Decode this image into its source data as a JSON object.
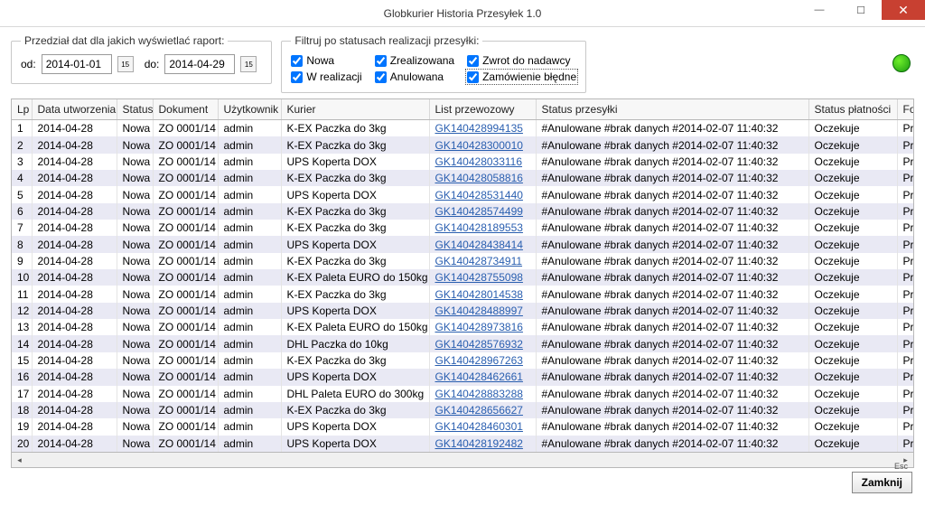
{
  "window": {
    "title": "Globkurier Historia Przesyłek 1.0"
  },
  "date_range": {
    "legend": "Przedział dat dla jakich wyświetlać raport:",
    "from_label": "od:",
    "from_value": "2014-01-01",
    "to_label": "do:",
    "to_value": "2014-04-29"
  },
  "filters": {
    "legend": "Filtruj po statusach realizacji przesyłki:",
    "nowa": "Nowa",
    "zrealizowana": "Zrealizowana",
    "zwrot": "Zwrot do nadawcy",
    "w_realizacji": "W realizacji",
    "anulowana": "Anulowana",
    "bledne": "Zamówienie błędne"
  },
  "columns": {
    "lp": "Lp",
    "data": "Data utworzenia",
    "status": "Status",
    "dokument": "Dokument",
    "uzytkownik": "Użytkownik",
    "kurier": "Kurier",
    "list": "List przewozowy",
    "status_p": "Status przesyłki",
    "status_pl": "Status płatności",
    "forma_pl": "Forma płatnoś"
  },
  "rows": [
    {
      "lp": "1",
      "data": "2014-04-28",
      "status": "Nowa",
      "dok": "ZO 0001/14",
      "user": "admin",
      "kurier": "K-EX Paczka do 3kg",
      "list": "GK140428994135",
      "sp": "#Anulowane #brak danych #2014-02-07 11:40:32",
      "spl": "Oczekuje",
      "fpl": "Przelew banko"
    },
    {
      "lp": "2",
      "data": "2014-04-28",
      "status": "Nowa",
      "dok": "ZO 0001/14",
      "user": "admin",
      "kurier": "K-EX Paczka do 3kg",
      "list": "GK140428300010",
      "sp": "#Anulowane #brak danych #2014-02-07 11:40:32",
      "spl": "Oczekuje",
      "fpl": "Przelew banko"
    },
    {
      "lp": "3",
      "data": "2014-04-28",
      "status": "Nowa",
      "dok": "ZO 0001/14",
      "user": "admin",
      "kurier": "UPS Koperta DOX",
      "list": "GK140428033116",
      "sp": "#Anulowane #brak danych #2014-02-07 11:40:32",
      "spl": "Oczekuje",
      "fpl": "Przelew banko"
    },
    {
      "lp": "4",
      "data": "2014-04-28",
      "status": "Nowa",
      "dok": "ZO 0001/14",
      "user": "admin",
      "kurier": "K-EX Paczka do 3kg",
      "list": "GK140428058816",
      "sp": "#Anulowane #brak danych #2014-02-07 11:40:32",
      "spl": "Oczekuje",
      "fpl": "Przelew banko"
    },
    {
      "lp": "5",
      "data": "2014-04-28",
      "status": "Nowa",
      "dok": "ZO 0001/14",
      "user": "admin",
      "kurier": "UPS Koperta DOX",
      "list": "GK140428531440",
      "sp": "#Anulowane #brak danych #2014-02-07 11:40:32",
      "spl": "Oczekuje",
      "fpl": "Przelew banko"
    },
    {
      "lp": "6",
      "data": "2014-04-28",
      "status": "Nowa",
      "dok": "ZO 0001/14",
      "user": "admin",
      "kurier": "K-EX Paczka do 3kg",
      "list": "GK140428574499",
      "sp": "#Anulowane #brak danych #2014-02-07 11:40:32",
      "spl": "Oczekuje",
      "fpl": "Przelew banko"
    },
    {
      "lp": "7",
      "data": "2014-04-28",
      "status": "Nowa",
      "dok": "ZO 0001/14",
      "user": "admin",
      "kurier": "K-EX Paczka do 3kg",
      "list": "GK140428189553",
      "sp": "#Anulowane #brak danych #2014-02-07 11:40:32",
      "spl": "Oczekuje",
      "fpl": "Przelew banko"
    },
    {
      "lp": "8",
      "data": "2014-04-28",
      "status": "Nowa",
      "dok": "ZO 0001/14",
      "user": "admin",
      "kurier": "UPS Koperta DOX",
      "list": "GK140428438414",
      "sp": "#Anulowane #brak danych #2014-02-07 11:40:32",
      "spl": "Oczekuje",
      "fpl": "Przelew banko"
    },
    {
      "lp": "9",
      "data": "2014-04-28",
      "status": "Nowa",
      "dok": "ZO 0001/14",
      "user": "admin",
      "kurier": "K-EX Paczka do 3kg",
      "list": "GK140428734911",
      "sp": "#Anulowane #brak danych #2014-02-07 11:40:32",
      "spl": "Oczekuje",
      "fpl": "Przelew banko"
    },
    {
      "lp": "10",
      "data": "2014-04-28",
      "status": "Nowa",
      "dok": "ZO 0001/14",
      "user": "admin",
      "kurier": "K-EX Paleta EURO do 150kg",
      "list": "GK140428755098",
      "sp": "#Anulowane #brak danych #2014-02-07 11:40:32",
      "spl": "Oczekuje",
      "fpl": "Przelew banko"
    },
    {
      "lp": "11",
      "data": "2014-04-28",
      "status": "Nowa",
      "dok": "ZO 0001/14",
      "user": "admin",
      "kurier": "K-EX Paczka do 3kg",
      "list": "GK140428014538",
      "sp": "#Anulowane #brak danych #2014-02-07 11:40:32",
      "spl": "Oczekuje",
      "fpl": "Przelew banko"
    },
    {
      "lp": "12",
      "data": "2014-04-28",
      "status": "Nowa",
      "dok": "ZO 0001/14",
      "user": "admin",
      "kurier": "UPS Koperta DOX",
      "list": "GK140428488997",
      "sp": "#Anulowane #brak danych #2014-02-07 11:40:32",
      "spl": "Oczekuje",
      "fpl": "Przelew banko"
    },
    {
      "lp": "13",
      "data": "2014-04-28",
      "status": "Nowa",
      "dok": "ZO 0001/14",
      "user": "admin",
      "kurier": "K-EX Paleta EURO do 150kg",
      "list": "GK140428973816",
      "sp": "#Anulowane #brak danych #2014-02-07 11:40:32",
      "spl": "Oczekuje",
      "fpl": "Przelew banko"
    },
    {
      "lp": "14",
      "data": "2014-04-28",
      "status": "Nowa",
      "dok": "ZO 0001/14",
      "user": "admin",
      "kurier": "DHL Paczka do 10kg",
      "list": "GK140428576932",
      "sp": "#Anulowane #brak danych #2014-02-07 11:40:32",
      "spl": "Oczekuje",
      "fpl": "Przelew banko"
    },
    {
      "lp": "15",
      "data": "2014-04-28",
      "status": "Nowa",
      "dok": "ZO 0001/14",
      "user": "admin",
      "kurier": "K-EX Paczka do 3kg",
      "list": "GK140428967263",
      "sp": "#Anulowane #brak danych #2014-02-07 11:40:32",
      "spl": "Oczekuje",
      "fpl": "Przelew banko"
    },
    {
      "lp": "16",
      "data": "2014-04-28",
      "status": "Nowa",
      "dok": "ZO 0001/14",
      "user": "admin",
      "kurier": "UPS Koperta DOX",
      "list": "GK140428462661",
      "sp": "#Anulowane #brak danych #2014-02-07 11:40:32",
      "spl": "Oczekuje",
      "fpl": "Przelew banko"
    },
    {
      "lp": "17",
      "data": "2014-04-28",
      "status": "Nowa",
      "dok": "ZO 0001/14",
      "user": "admin",
      "kurier": "DHL Paleta EURO do 300kg",
      "list": "GK140428883288",
      "sp": "#Anulowane #brak danych #2014-02-07 11:40:32",
      "spl": "Oczekuje",
      "fpl": "Przelew banko"
    },
    {
      "lp": "18",
      "data": "2014-04-28",
      "status": "Nowa",
      "dok": "ZO 0001/14",
      "user": "admin",
      "kurier": "K-EX Paczka do 3kg",
      "list": "GK140428656627",
      "sp": "#Anulowane #brak danych #2014-02-07 11:40:32",
      "spl": "Oczekuje",
      "fpl": "Przelew banko"
    },
    {
      "lp": "19",
      "data": "2014-04-28",
      "status": "Nowa",
      "dok": "ZO 0001/14",
      "user": "admin",
      "kurier": "UPS Koperta DOX",
      "list": "GK140428460301",
      "sp": "#Anulowane #brak danych #2014-02-07 11:40:32",
      "spl": "Oczekuje",
      "fpl": "Przelew banko"
    },
    {
      "lp": "20",
      "data": "2014-04-28",
      "status": "Nowa",
      "dok": "ZO 0001/14",
      "user": "admin",
      "kurier": "UPS Koperta DOX",
      "list": "GK140428192482",
      "sp": "#Anulowane #brak danych #2014-02-07 11:40:32",
      "spl": "Oczekuje",
      "fpl": "Przelew banko"
    }
  ],
  "footer": {
    "esc": "Esc",
    "zamknij": "Zamknij"
  }
}
